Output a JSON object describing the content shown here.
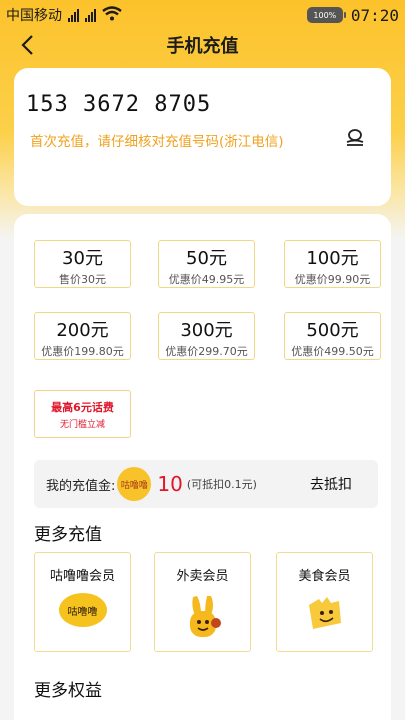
{
  "status_bar": {
    "carrier": "中国移动",
    "battery": "100%",
    "time": "07:20"
  },
  "nav": {
    "title": "手机充值"
  },
  "phone": {
    "number": "153 3672 8705",
    "hint": "首次充值，请仔细核对充值号码(浙江电信)"
  },
  "amounts": [
    {
      "main": "30元",
      "sub": "售价30元"
    },
    {
      "main": "50元",
      "sub": "优惠价49.95元"
    },
    {
      "main": "100元",
      "sub": "优惠价99.90元"
    },
    {
      "main": "200元",
      "sub": "优惠价199.80元"
    },
    {
      "main": "300元",
      "sub": "优惠价299.70元"
    },
    {
      "main": "500元",
      "sub": "优惠价499.50元"
    }
  ],
  "promo": {
    "main": "最高6元话费",
    "sub": "无门槛立减"
  },
  "gold": {
    "label": "我的充值金:",
    "coin": "咕噜噜",
    "amount": "10",
    "note": "(可抵扣0.1元)",
    "action": "去抵扣"
  },
  "more_recharge": {
    "title": "更多充值",
    "items": [
      {
        "label": "咕噜噜会员",
        "icon_text": "咕噜噜"
      },
      {
        "label": "外卖会员"
      },
      {
        "label": "美食会员"
      }
    ]
  },
  "more_benefits": {
    "title": "更多权益"
  },
  "colors": {
    "brand_yellow": "#fcc22b",
    "accent_orange": "#f0a21d",
    "price_red": "#e0162b",
    "card_border": "#f0d889"
  }
}
